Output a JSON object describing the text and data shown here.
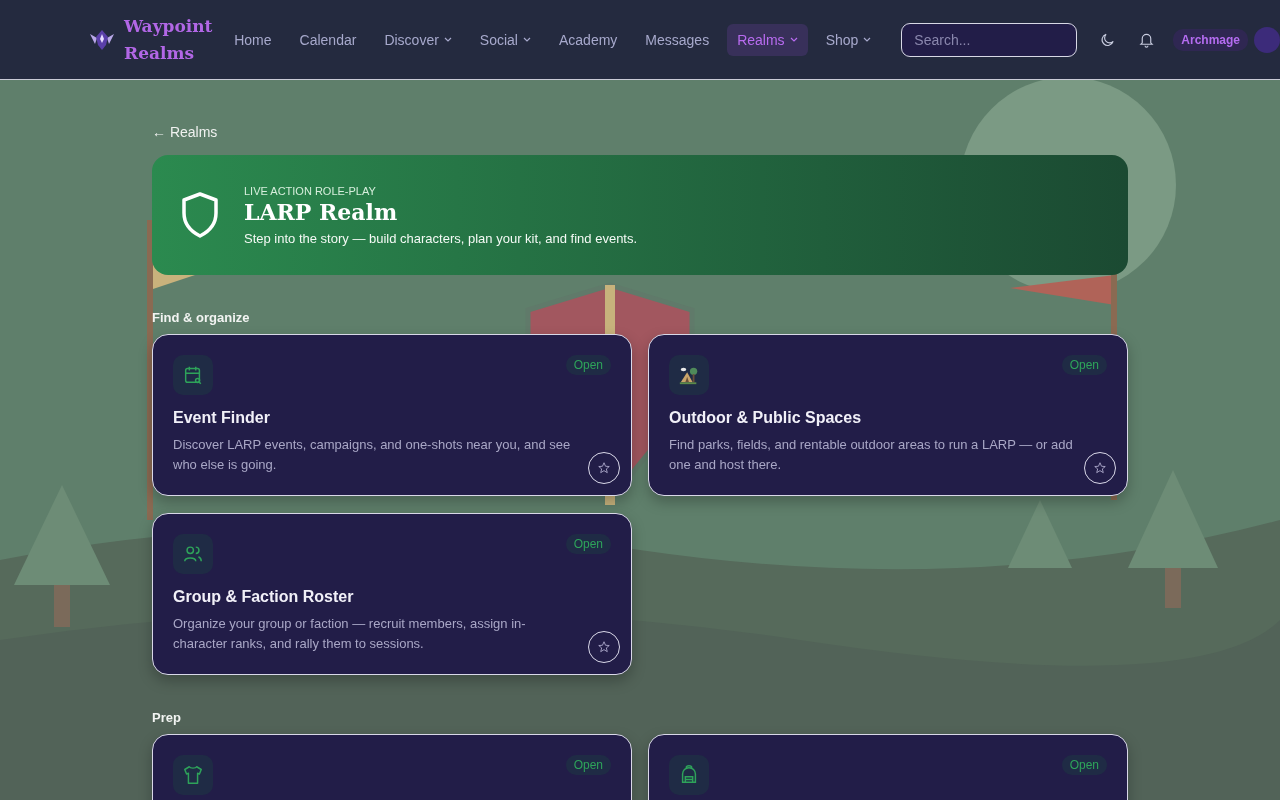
{
  "brand": {
    "name": "Waypoint Realms"
  },
  "nav": [
    {
      "label": "Home",
      "selected": false,
      "dropdown": false
    },
    {
      "label": "Calendar",
      "selected": false,
      "dropdown": false
    },
    {
      "label": "Discover",
      "selected": false,
      "dropdown": true
    },
    {
      "label": "Social",
      "selected": false,
      "dropdown": true
    },
    {
      "label": "Academy",
      "selected": false,
      "dropdown": false
    },
    {
      "label": "Messages",
      "selected": false,
      "dropdown": false
    },
    {
      "label": "Realms",
      "selected": true,
      "dropdown": true
    },
    {
      "label": "Shop",
      "selected": false,
      "dropdown": true
    }
  ],
  "search": {
    "placeholder": "Search..."
  },
  "user": {
    "role": "Archmage"
  },
  "back_link": "← Realms",
  "banner": {
    "eyebrow": "LIVE ACTION ROLE-PLAY",
    "title": "LARP Realm",
    "subtitle": "Step into the story — build characters, plan your kit, and find events."
  },
  "sections": [
    {
      "title": "Find & organize",
      "cards": [
        {
          "status": "Open",
          "title": "Event Finder",
          "description": "Discover LARP events, campaigns, and one-shots near you, and see who else is going.",
          "favorite": false
        },
        {
          "status": "Open",
          "title": "Outdoor & Public Spaces",
          "description": "Find parks, fields, and rentable outdoor areas to run a LARP — or add one and host there.",
          "favorite": false
        },
        {
          "status": "Open",
          "title": "Group & Faction Roster",
          "description": "Organize your group or faction — recruit members, assign in-character ranks, and rally them to sessions.",
          "favorite": false
        }
      ]
    },
    {
      "title": "Prep",
      "cards": [
        {
          "status": "Open"
        },
        {
          "status": "Open"
        }
      ]
    }
  ]
}
